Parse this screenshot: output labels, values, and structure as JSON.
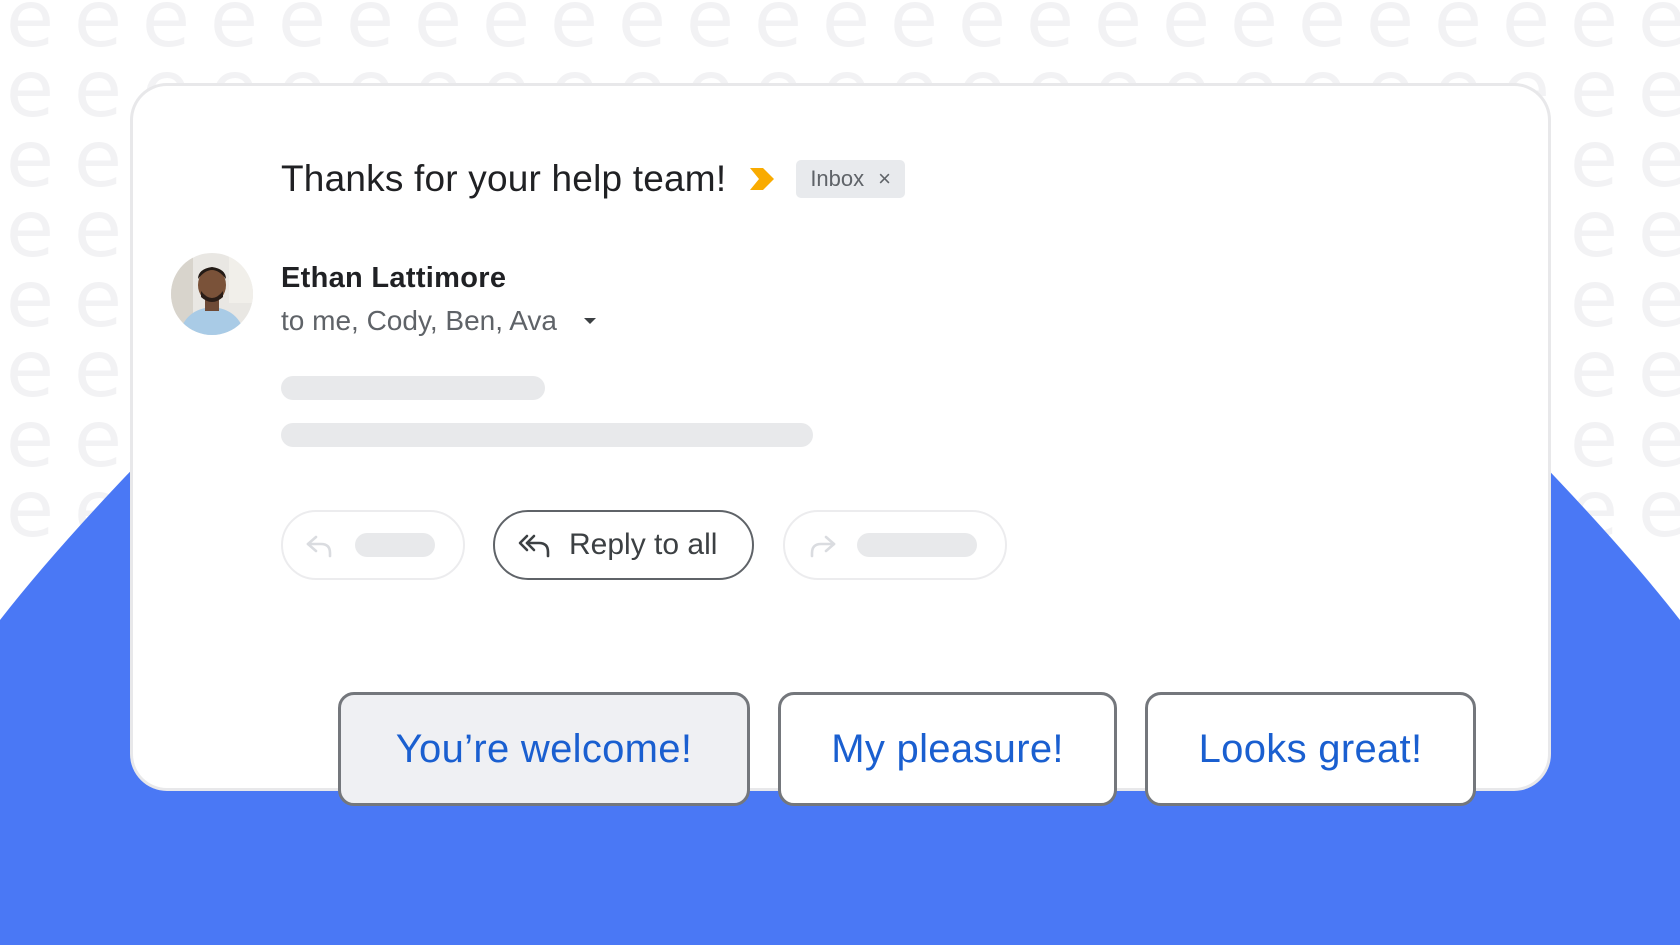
{
  "theme": {
    "background": "#ffffff",
    "pattern_color": "#f1f1f3",
    "accent_blue": "#4a78f5",
    "importance_color": "#f9ab00",
    "smart_reply_text_color": "#1a5fd0"
  },
  "email": {
    "subject": "Thanks for your help team!",
    "importance_icon": "importance-marker-icon",
    "label_chip": {
      "label": "Inbox",
      "close_symbol": "×"
    },
    "sender": {
      "name": "Ethan Lattimore",
      "recipients": "to me, Cody, Ben, Ava",
      "avatar_icon": "avatar-photo",
      "toggle_icon": "caret-down-icon"
    }
  },
  "actions": {
    "reply": {
      "icon": "reply-icon"
    },
    "reply_all": {
      "label": "Reply to all",
      "icon": "reply-all-icon"
    },
    "forward": {
      "icon": "forward-icon"
    }
  },
  "smart_replies": [
    {
      "label": "You’re welcome!"
    },
    {
      "label": "My pleasure!"
    },
    {
      "label": "Looks great!"
    }
  ]
}
